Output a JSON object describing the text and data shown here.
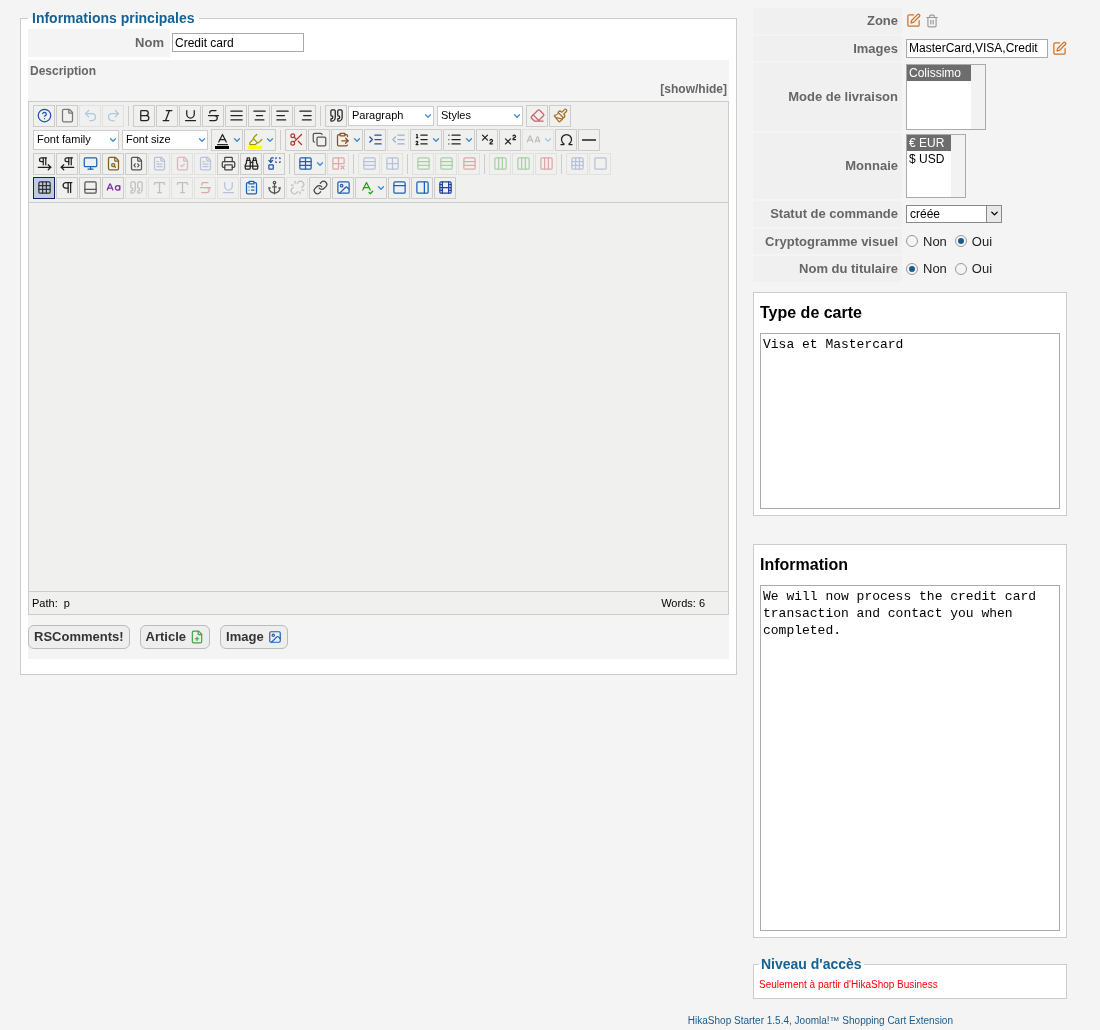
{
  "main": {
    "legend": "Informations principales",
    "name_label": "Nom",
    "name_value": "Credit card",
    "description_label": "Description",
    "toggle_link": "[show/hide]",
    "toolbar_rows": [
      [
        {
          "kind": "button",
          "disabled": false,
          "pressed": false
        },
        {
          "kind": "button",
          "disabled": false,
          "pressed": false
        },
        {
          "kind": "button",
          "disabled": true,
          "pressed": false
        },
        {
          "kind": "button",
          "disabled": true,
          "pressed": false
        },
        {
          "kind": "separator"
        },
        {
          "kind": "button",
          "disabled": false,
          "pressed": false
        },
        {
          "kind": "button",
          "disabled": false,
          "pressed": false
        },
        {
          "kind": "button",
          "disabled": false,
          "pressed": false
        },
        {
          "kind": "button",
          "disabled": false,
          "pressed": false
        },
        {
          "kind": "button",
          "disabled": false,
          "pressed": false
        },
        {
          "kind": "button",
          "disabled": false,
          "pressed": false
        },
        {
          "kind": "button",
          "disabled": false,
          "pressed": false
        },
        {
          "kind": "button",
          "disabled": false,
          "pressed": false
        },
        {
          "kind": "separator"
        },
        {
          "kind": "button",
          "disabled": false,
          "pressed": false
        },
        {
          "kind": "select",
          "value": "Paragraph"
        },
        {
          "kind": "select",
          "value": "Styles"
        },
        {
          "kind": "button",
          "disabled": false,
          "pressed": false
        },
        {
          "kind": "button",
          "disabled": false,
          "pressed": false
        }
      ],
      [
        {
          "kind": "select",
          "value": "Font family"
        },
        {
          "kind": "select",
          "value": "Font size"
        },
        {
          "kind": "split",
          "disabled": false,
          "pressed": false,
          "color": "#000000"
        },
        {
          "kind": "split",
          "disabled": false,
          "pressed": false,
          "color": "#ffff00"
        },
        {
          "kind": "separator"
        },
        {
          "kind": "button",
          "disabled": false,
          "pressed": false
        },
        {
          "kind": "button",
          "disabled": false,
          "pressed": false
        },
        {
          "kind": "split",
          "disabled": false,
          "pressed": false
        },
        {
          "kind": "button",
          "disabled": false,
          "pressed": false
        },
        {
          "kind": "button",
          "disabled": true,
          "pressed": false
        },
        {
          "kind": "split",
          "disabled": false,
          "pressed": false
        },
        {
          "kind": "split",
          "disabled": false,
          "pressed": false
        },
        {
          "kind": "button",
          "disabled": false,
          "pressed": false
        },
        {
          "kind": "button",
          "disabled": false,
          "pressed": false
        },
        {
          "kind": "split",
          "disabled": true,
          "pressed": false
        },
        {
          "kind": "button",
          "disabled": false,
          "pressed": false
        },
        {
          "kind": "button",
          "disabled": false,
          "pressed": false
        }
      ],
      [
        {
          "kind": "button",
          "disabled": false,
          "pressed": false
        },
        {
          "kind": "button",
          "disabled": false,
          "pressed": false
        },
        {
          "kind": "button",
          "disabled": false,
          "pressed": false
        },
        {
          "kind": "button",
          "disabled": false,
          "pressed": false
        },
        {
          "kind": "button",
          "disabled": false,
          "pressed": false
        },
        {
          "kind": "button",
          "disabled": true,
          "pressed": false
        },
        {
          "kind": "button",
          "disabled": true,
          "pressed": false
        },
        {
          "kind": "button",
          "disabled": true,
          "pressed": false
        },
        {
          "kind": "button",
          "disabled": false,
          "pressed": false
        },
        {
          "kind": "button",
          "disabled": false,
          "pressed": false
        },
        {
          "kind": "button",
          "disabled": false,
          "pressed": false
        },
        {
          "kind": "separator"
        },
        {
          "kind": "split",
          "disabled": false,
          "pressed": false
        },
        {
          "kind": "button",
          "disabled": true,
          "pressed": false
        },
        {
          "kind": "separator"
        },
        {
          "kind": "button",
          "disabled": true,
          "pressed": false
        },
        {
          "kind": "button",
          "disabled": true,
          "pressed": false
        },
        {
          "kind": "separator"
        },
        {
          "kind": "button",
          "disabled": true,
          "pressed": false
        },
        {
          "kind": "button",
          "disabled": true,
          "pressed": false
        },
        {
          "kind": "button",
          "disabled": true,
          "pressed": false
        },
        {
          "kind": "separator"
        },
        {
          "kind": "button",
          "disabled": true,
          "pressed": false
        },
        {
          "kind": "button",
          "disabled": true,
          "pressed": false
        },
        {
          "kind": "button",
          "disabled": true,
          "pressed": false
        },
        {
          "kind": "separator"
        },
        {
          "kind": "button",
          "disabled": true,
          "pressed": false
        },
        {
          "kind": "button",
          "disabled": true,
          "pressed": false
        }
      ],
      [
        {
          "kind": "button",
          "disabled": false,
          "pressed": true
        },
        {
          "kind": "button",
          "disabled": false,
          "pressed": false
        },
        {
          "kind": "button",
          "disabled": false,
          "pressed": false
        },
        {
          "kind": "button",
          "disabled": false,
          "pressed": false
        },
        {
          "kind": "button",
          "disabled": true,
          "pressed": false
        },
        {
          "kind": "button",
          "disabled": true,
          "pressed": false
        },
        {
          "kind": "button",
          "disabled": true,
          "pressed": false
        },
        {
          "kind": "button",
          "disabled": true,
          "pressed": false
        },
        {
          "kind": "button",
          "disabled": true,
          "pressed": false
        },
        {
          "kind": "button",
          "disabled": false,
          "pressed": false
        },
        {
          "kind": "button",
          "disabled": false,
          "pressed": false
        },
        {
          "kind": "button",
          "disabled": true,
          "pressed": false
        },
        {
          "kind": "button",
          "disabled": false,
          "pressed": false
        },
        {
          "kind": "button",
          "disabled": false,
          "pressed": false
        },
        {
          "kind": "split",
          "disabled": false,
          "pressed": false
        },
        {
          "kind": "button",
          "disabled": false,
          "pressed": false
        },
        {
          "kind": "button",
          "disabled": false,
          "pressed": false
        },
        {
          "kind": "button",
          "disabled": false,
          "pressed": false
        }
      ]
    ],
    "path_label": "Path:",
    "path_value": "p",
    "word_count": "Words: 6",
    "extra_buttons": [
      {
        "label": "RSComments!",
        "kind": "plain"
      },
      {
        "label": "Article",
        "kind": "article"
      },
      {
        "label": "Image",
        "kind": "image"
      }
    ]
  },
  "settings": [
    {
      "label": "Zone",
      "kind": "icons"
    },
    {
      "label": "Images",
      "kind": "text",
      "value": "MasterCard,VISA,Credit"
    },
    {
      "label": "Mode de livraison",
      "kind": "listbox",
      "options": [
        {
          "label": "Colissimo",
          "selected": true
        }
      ]
    },
    {
      "label": "Monnaie",
      "kind": "listbox",
      "options": [
        {
          "label": "€ EUR",
          "selected": true
        },
        {
          "label": "$ USD",
          "selected": false
        }
      ]
    },
    {
      "label": "Statut de commande",
      "kind": "select",
      "value": "créée"
    },
    {
      "label": "Cryptogramme visuel",
      "kind": "radio",
      "options": [
        {
          "label": "Non",
          "selected": false
        },
        {
          "label": "Oui",
          "selected": true
        }
      ]
    },
    {
      "label": "Nom du titulaire",
      "kind": "radio",
      "options": [
        {
          "label": "Non",
          "selected": true
        },
        {
          "label": "Oui",
          "selected": false
        }
      ]
    }
  ],
  "panels": [
    {
      "title": "Type de carte",
      "text": "Visa et Mastercard"
    },
    {
      "title": "Information",
      "text": "We will now process the credit card transaction and contact you when completed."
    }
  ],
  "access": {
    "legend": "Niveau d'accès",
    "notice": "Seulement à partir d'HikaShop Business"
  },
  "footer": "HikaShop Starter 1.5.4, Joomla!™ Shopping Cart Extension"
}
